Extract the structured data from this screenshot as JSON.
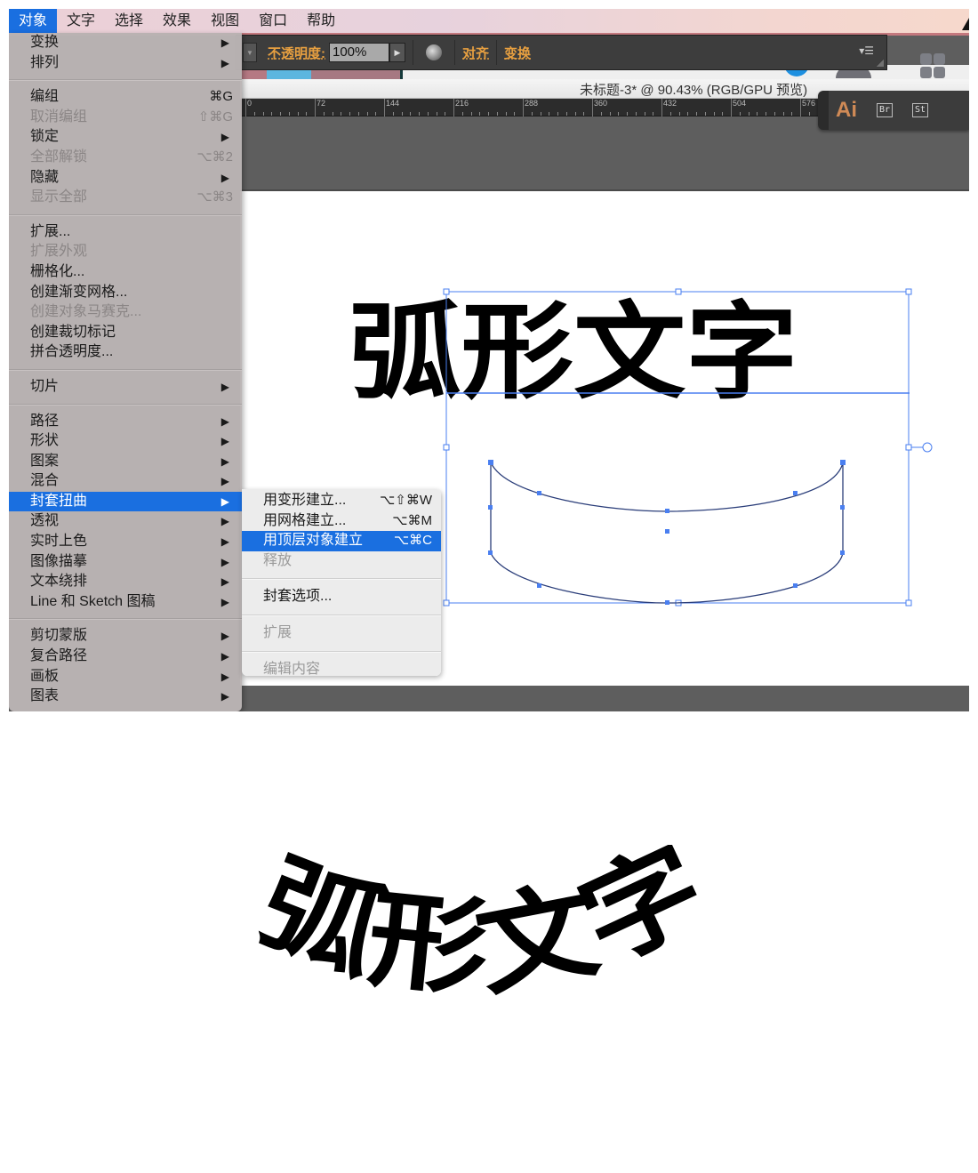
{
  "menubar": {
    "items": [
      "对象",
      "文字",
      "选择",
      "效果",
      "视图",
      "窗口",
      "帮助"
    ],
    "active_index": 0
  },
  "control_bar": {
    "opacity_label": "不透明度:",
    "opacity_value": "100%",
    "align_label": "对齐",
    "transform_label": "变换",
    "panel_menu_icon": "panel-menu-icon"
  },
  "document": {
    "title": "未标题-3* @ 90.43% (RGB/GPU 预览)"
  },
  "ruler": {
    "labels": [
      "0",
      "72",
      "144",
      "216",
      "288",
      "360",
      "432",
      "504",
      "576"
    ]
  },
  "cc_switcher": {
    "ai": "Ai",
    "br": "Br",
    "st": "St"
  },
  "canvas": {
    "text": "弧形文字",
    "selection_color": "#4a7ff0"
  },
  "object_menu": {
    "groups": [
      [
        {
          "label": "变换",
          "arrow": true
        },
        {
          "label": "排列",
          "arrow": true
        }
      ],
      [
        {
          "label": "编组",
          "shortcut": "⌘G"
        },
        {
          "label": "取消编组",
          "shortcut": "⇧⌘G",
          "disabled": true
        },
        {
          "label": "锁定",
          "arrow": true
        },
        {
          "label": "全部解锁",
          "shortcut": "⌥⌘2",
          "disabled": true
        },
        {
          "label": "隐藏",
          "arrow": true
        },
        {
          "label": "显示全部",
          "shortcut": "⌥⌘3",
          "disabled": true
        }
      ],
      [
        {
          "label": "扩展..."
        },
        {
          "label": "扩展外观",
          "disabled": true
        },
        {
          "label": "栅格化..."
        },
        {
          "label": "创建渐变网格..."
        },
        {
          "label": "创建对象马赛克...",
          "disabled": true
        },
        {
          "label": "创建裁切标记"
        },
        {
          "label": "拼合透明度..."
        }
      ],
      [
        {
          "label": "切片",
          "arrow": true
        }
      ],
      [
        {
          "label": "路径",
          "arrow": true
        },
        {
          "label": "形状",
          "arrow": true
        },
        {
          "label": "图案",
          "arrow": true
        },
        {
          "label": "混合",
          "arrow": true
        },
        {
          "label": "封套扭曲",
          "arrow": true,
          "highlighted": true
        },
        {
          "label": "透视",
          "arrow": true
        },
        {
          "label": "实时上色",
          "arrow": true
        },
        {
          "label": "图像描摹",
          "arrow": true
        },
        {
          "label": "文本绕排",
          "arrow": true
        },
        {
          "label": "Line 和 Sketch 图稿",
          "arrow": true
        }
      ],
      [
        {
          "label": "剪切蒙版",
          "arrow": true
        },
        {
          "label": "复合路径",
          "arrow": true
        },
        {
          "label": "画板",
          "arrow": true
        },
        {
          "label": "图表",
          "arrow": true
        }
      ]
    ]
  },
  "envelope_menu": {
    "groups": [
      [
        {
          "label": "用变形建立...",
          "shortcut": "⌥⇧⌘W"
        },
        {
          "label": "用网格建立...",
          "shortcut": "⌥⌘M"
        },
        {
          "label": "用顶层对象建立",
          "shortcut": "⌥⌘C",
          "highlighted": true
        },
        {
          "label": "释放",
          "disabled": true
        }
      ],
      [
        {
          "label": "封套选项..."
        }
      ],
      [
        {
          "label": "扩展",
          "disabled": true
        }
      ],
      [
        {
          "label": "编辑内容",
          "disabled": true
        }
      ]
    ]
  },
  "result": {
    "text": "弧形文字"
  },
  "colors": {
    "menu_highlight": "#1a6fe0",
    "control_accent": "#e8a040",
    "selection_blue": "#4a7ff0",
    "ai_brand": "#d08a56"
  }
}
